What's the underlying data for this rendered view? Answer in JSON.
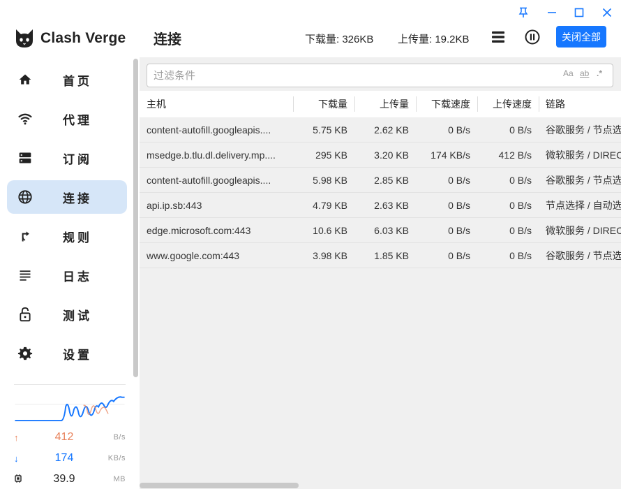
{
  "app": {
    "name": "Clash Verge"
  },
  "sidebar": {
    "items": [
      {
        "label": "首页",
        "icon": "home-icon"
      },
      {
        "label": "代理",
        "icon": "wifi-icon"
      },
      {
        "label": "订阅",
        "icon": "storage-icon"
      },
      {
        "label": "连接",
        "icon": "globe-icon",
        "active": true
      },
      {
        "label": "规则",
        "icon": "fork-arrow-icon"
      },
      {
        "label": "日志",
        "icon": "list-icon"
      },
      {
        "label": "测试",
        "icon": "lock-icon"
      },
      {
        "label": "设置",
        "icon": "gear-icon"
      }
    ]
  },
  "traffic": {
    "upload": {
      "value": "412",
      "unit": "B/s",
      "color": "#e8825b"
    },
    "download": {
      "value": "174",
      "unit": "KB/s",
      "color": "#1677ff"
    },
    "memory": {
      "value": "39.9",
      "unit": "MB"
    }
  },
  "header": {
    "title": "连接",
    "download_total": "下载量: 326KB",
    "upload_total": "上传量: 19.2KB",
    "close_all_label": "关闭全部"
  },
  "filter": {
    "placeholder": "过滤条件",
    "toggles": [
      "Aa",
      "ab",
      ".*"
    ]
  },
  "table": {
    "columns": [
      "主机",
      "下载量",
      "上传量",
      "下载速度",
      "上传速度",
      "链路"
    ],
    "rows": [
      [
        "content-autofill.googleapis....",
        "5.75 KB",
        "2.62 KB",
        "0 B/s",
        "0 B/s",
        "谷歌服务 / 节点选"
      ],
      [
        "msedge.b.tlu.dl.delivery.mp....",
        "295 KB",
        "3.20 KB",
        "174 KB/s",
        "412 B/s",
        "微软服务 / DIRECT"
      ],
      [
        "content-autofill.googleapis....",
        "5.98 KB",
        "2.85 KB",
        "0 B/s",
        "0 B/s",
        "谷歌服务 / 节点选"
      ],
      [
        "api.ip.sb:443",
        "4.79 KB",
        "2.63 KB",
        "0 B/s",
        "0 B/s",
        "节点选择 / 自动选"
      ],
      [
        "edge.microsoft.com:443",
        "10.6 KB",
        "6.03 KB",
        "0 B/s",
        "0 B/s",
        "微软服务 / DIRECT"
      ],
      [
        "www.google.com:443",
        "3.98 KB",
        "1.85 KB",
        "0 B/s",
        "0 B/s",
        "谷歌服务 / 节点选"
      ]
    ]
  },
  "colors": {
    "accent": "#1677ff",
    "active_nav": "#d6e6f8"
  }
}
